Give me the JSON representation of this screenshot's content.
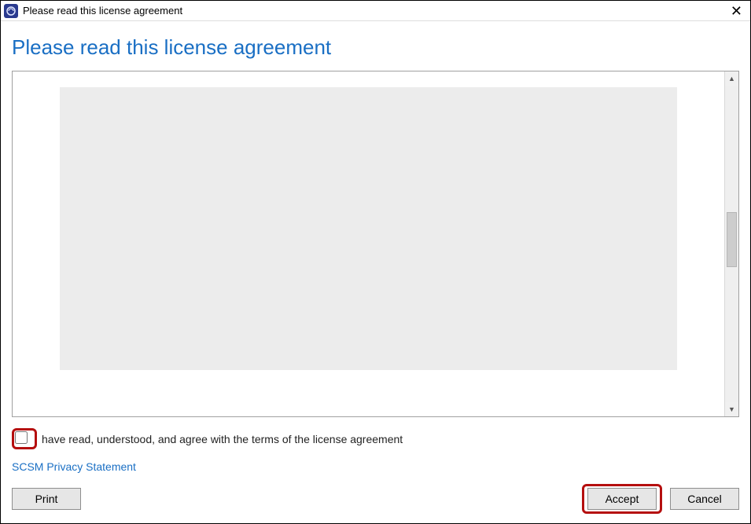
{
  "window": {
    "title": "Please read this license agreement"
  },
  "page": {
    "heading": "Please read this license agreement"
  },
  "agreement": {
    "checkbox_label": "have read, understood, and agree with the terms of the license agreement",
    "checked": false
  },
  "links": {
    "privacy": "SCSM Privacy Statement"
  },
  "buttons": {
    "print": "Print",
    "accept": "Accept",
    "cancel": "Cancel"
  }
}
